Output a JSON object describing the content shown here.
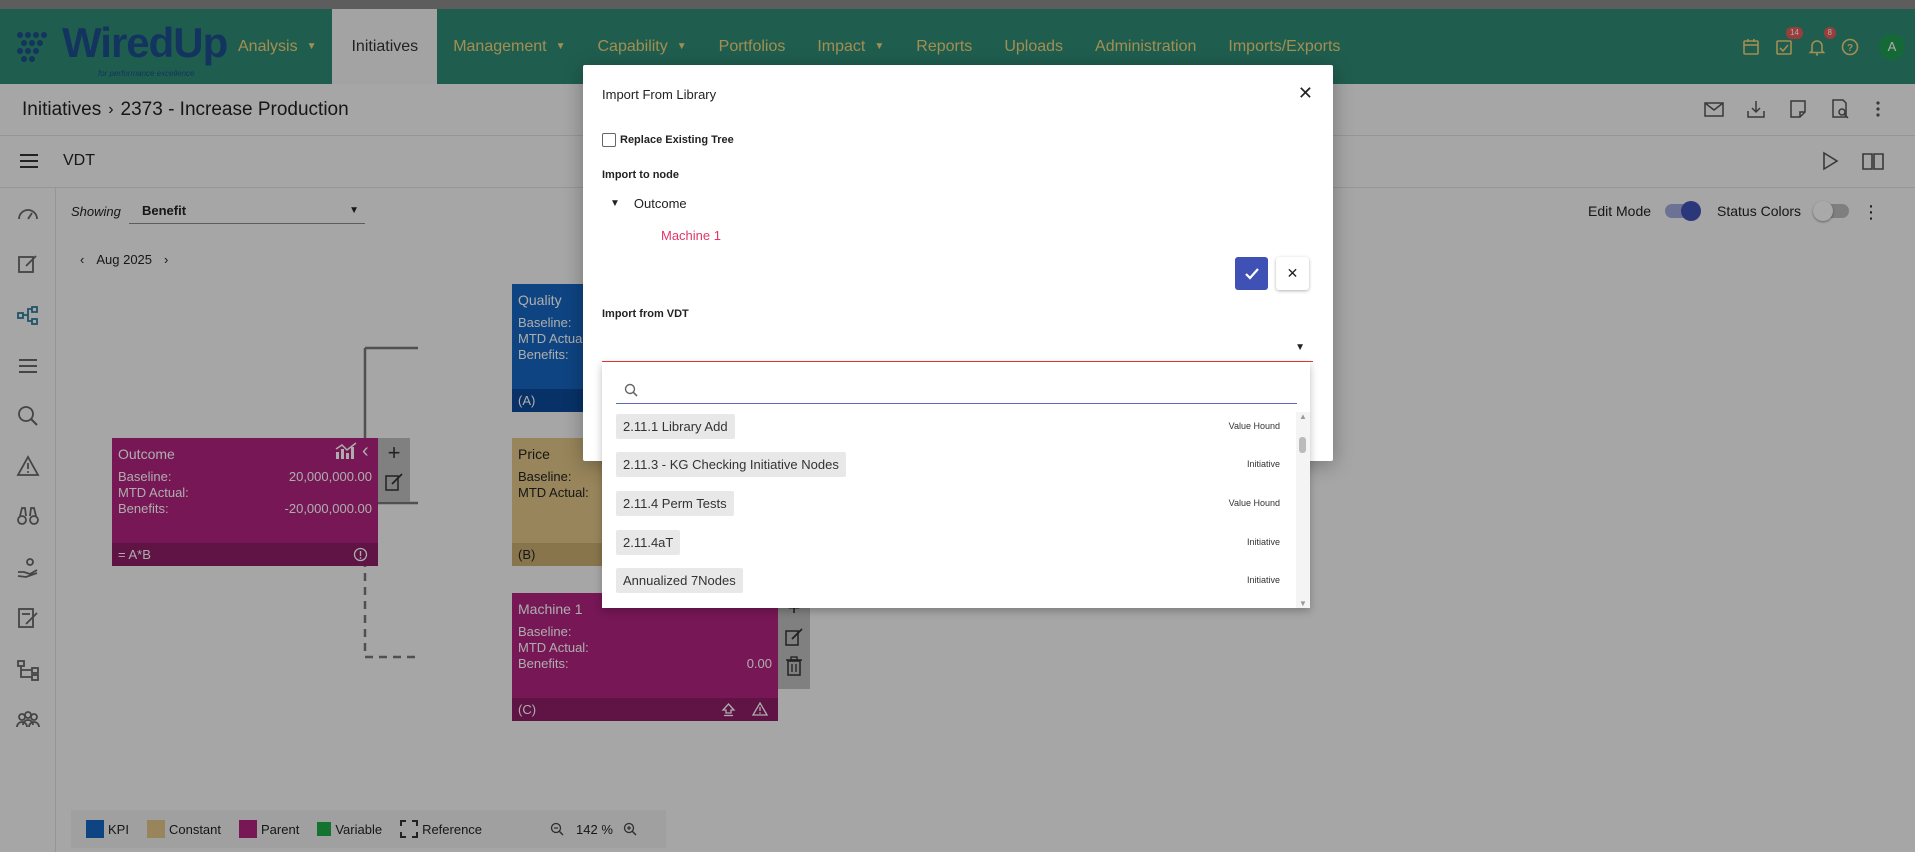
{
  "header": {
    "logo_text": "WiredUp",
    "logo_tagline": "for performance excellence",
    "nav": [
      {
        "label": "Analysis",
        "caret": true
      },
      {
        "label": "Initiatives",
        "caret": false,
        "active": true
      },
      {
        "label": "Management",
        "caret": true
      },
      {
        "label": "Capability",
        "caret": true
      },
      {
        "label": "Portfolios",
        "caret": false
      },
      {
        "label": "Impact",
        "caret": true
      },
      {
        "label": "Reports",
        "caret": false
      },
      {
        "label": "Uploads",
        "caret": false
      },
      {
        "label": "Administration",
        "caret": false
      },
      {
        "label": "Imports/Exports",
        "caret": false
      }
    ],
    "tasks_badge": "14",
    "notifications_badge": "8",
    "avatar_initial": "A",
    "nav_text_color": "#f0d27a",
    "bar_color": "#2e8b75"
  },
  "breadcrumb": {
    "root": "Initiatives",
    "current": "2373 - Increase Production"
  },
  "vdt_bar": {
    "title": "VDT"
  },
  "canvas": {
    "showing_label": "Showing",
    "showing_value": "Benefit",
    "month": "Aug 2025",
    "edit_mode_label": "Edit Mode",
    "status_colors_label": "Status Colors",
    "edit_mode_on": true,
    "status_colors_on": false,
    "nodes": {
      "outcome": {
        "title": "Outcome",
        "baseline_label": "Baseline:",
        "baseline": "20,000,000.00",
        "mtd_label": "MTD Actual:",
        "benefits_label": "Benefits:",
        "benefits": "-20,000,000.00",
        "footer": "= A*B"
      },
      "quality": {
        "title": "Quality",
        "baseline_label": "Baseline:",
        "mtd_label": "MTD Actual:",
        "benefits_label": "Benefits:",
        "footer": "(A)"
      },
      "price": {
        "title": "Price",
        "baseline_label": "Baseline:",
        "mtd_label": "MTD Actual:",
        "footer": "(B)"
      },
      "machine": {
        "title": "Machine 1",
        "baseline_label": "Baseline:",
        "mtd_label": "MTD Actual:",
        "benefits_label": "Benefits:",
        "benefits": "0.00",
        "footer": "(C)"
      }
    },
    "legend": [
      {
        "label": "KPI",
        "color": "#1565c0"
      },
      {
        "label": "Constant",
        "color": "#e0c586"
      },
      {
        "label": "Parent",
        "color": "#b0237f"
      },
      {
        "label": "Variable",
        "color": "#1faa48"
      },
      {
        "label": "Reference",
        "color": "dashed"
      }
    ],
    "zoom": "142 %"
  },
  "modal": {
    "title": "Import From Library",
    "replace_label": "Replace Existing Tree",
    "import_to_label": "Import to node",
    "tree_root": "Outcome",
    "tree_child": "Machine 1",
    "import_from_label": "Import from VDT",
    "search_placeholder": ""
  },
  "dropdown": {
    "items": [
      {
        "label": "2.11.1 Library Add",
        "type": "Value Hound"
      },
      {
        "label": "2.11.3 - KG Checking Initiative Nodes",
        "type": "Initiative"
      },
      {
        "label": "2.11.4 Perm Tests",
        "type": "Value Hound"
      },
      {
        "label": "2.11.4aT",
        "type": "Initiative"
      },
      {
        "label": "Annualized 7Nodes",
        "type": "Initiative"
      }
    ]
  }
}
